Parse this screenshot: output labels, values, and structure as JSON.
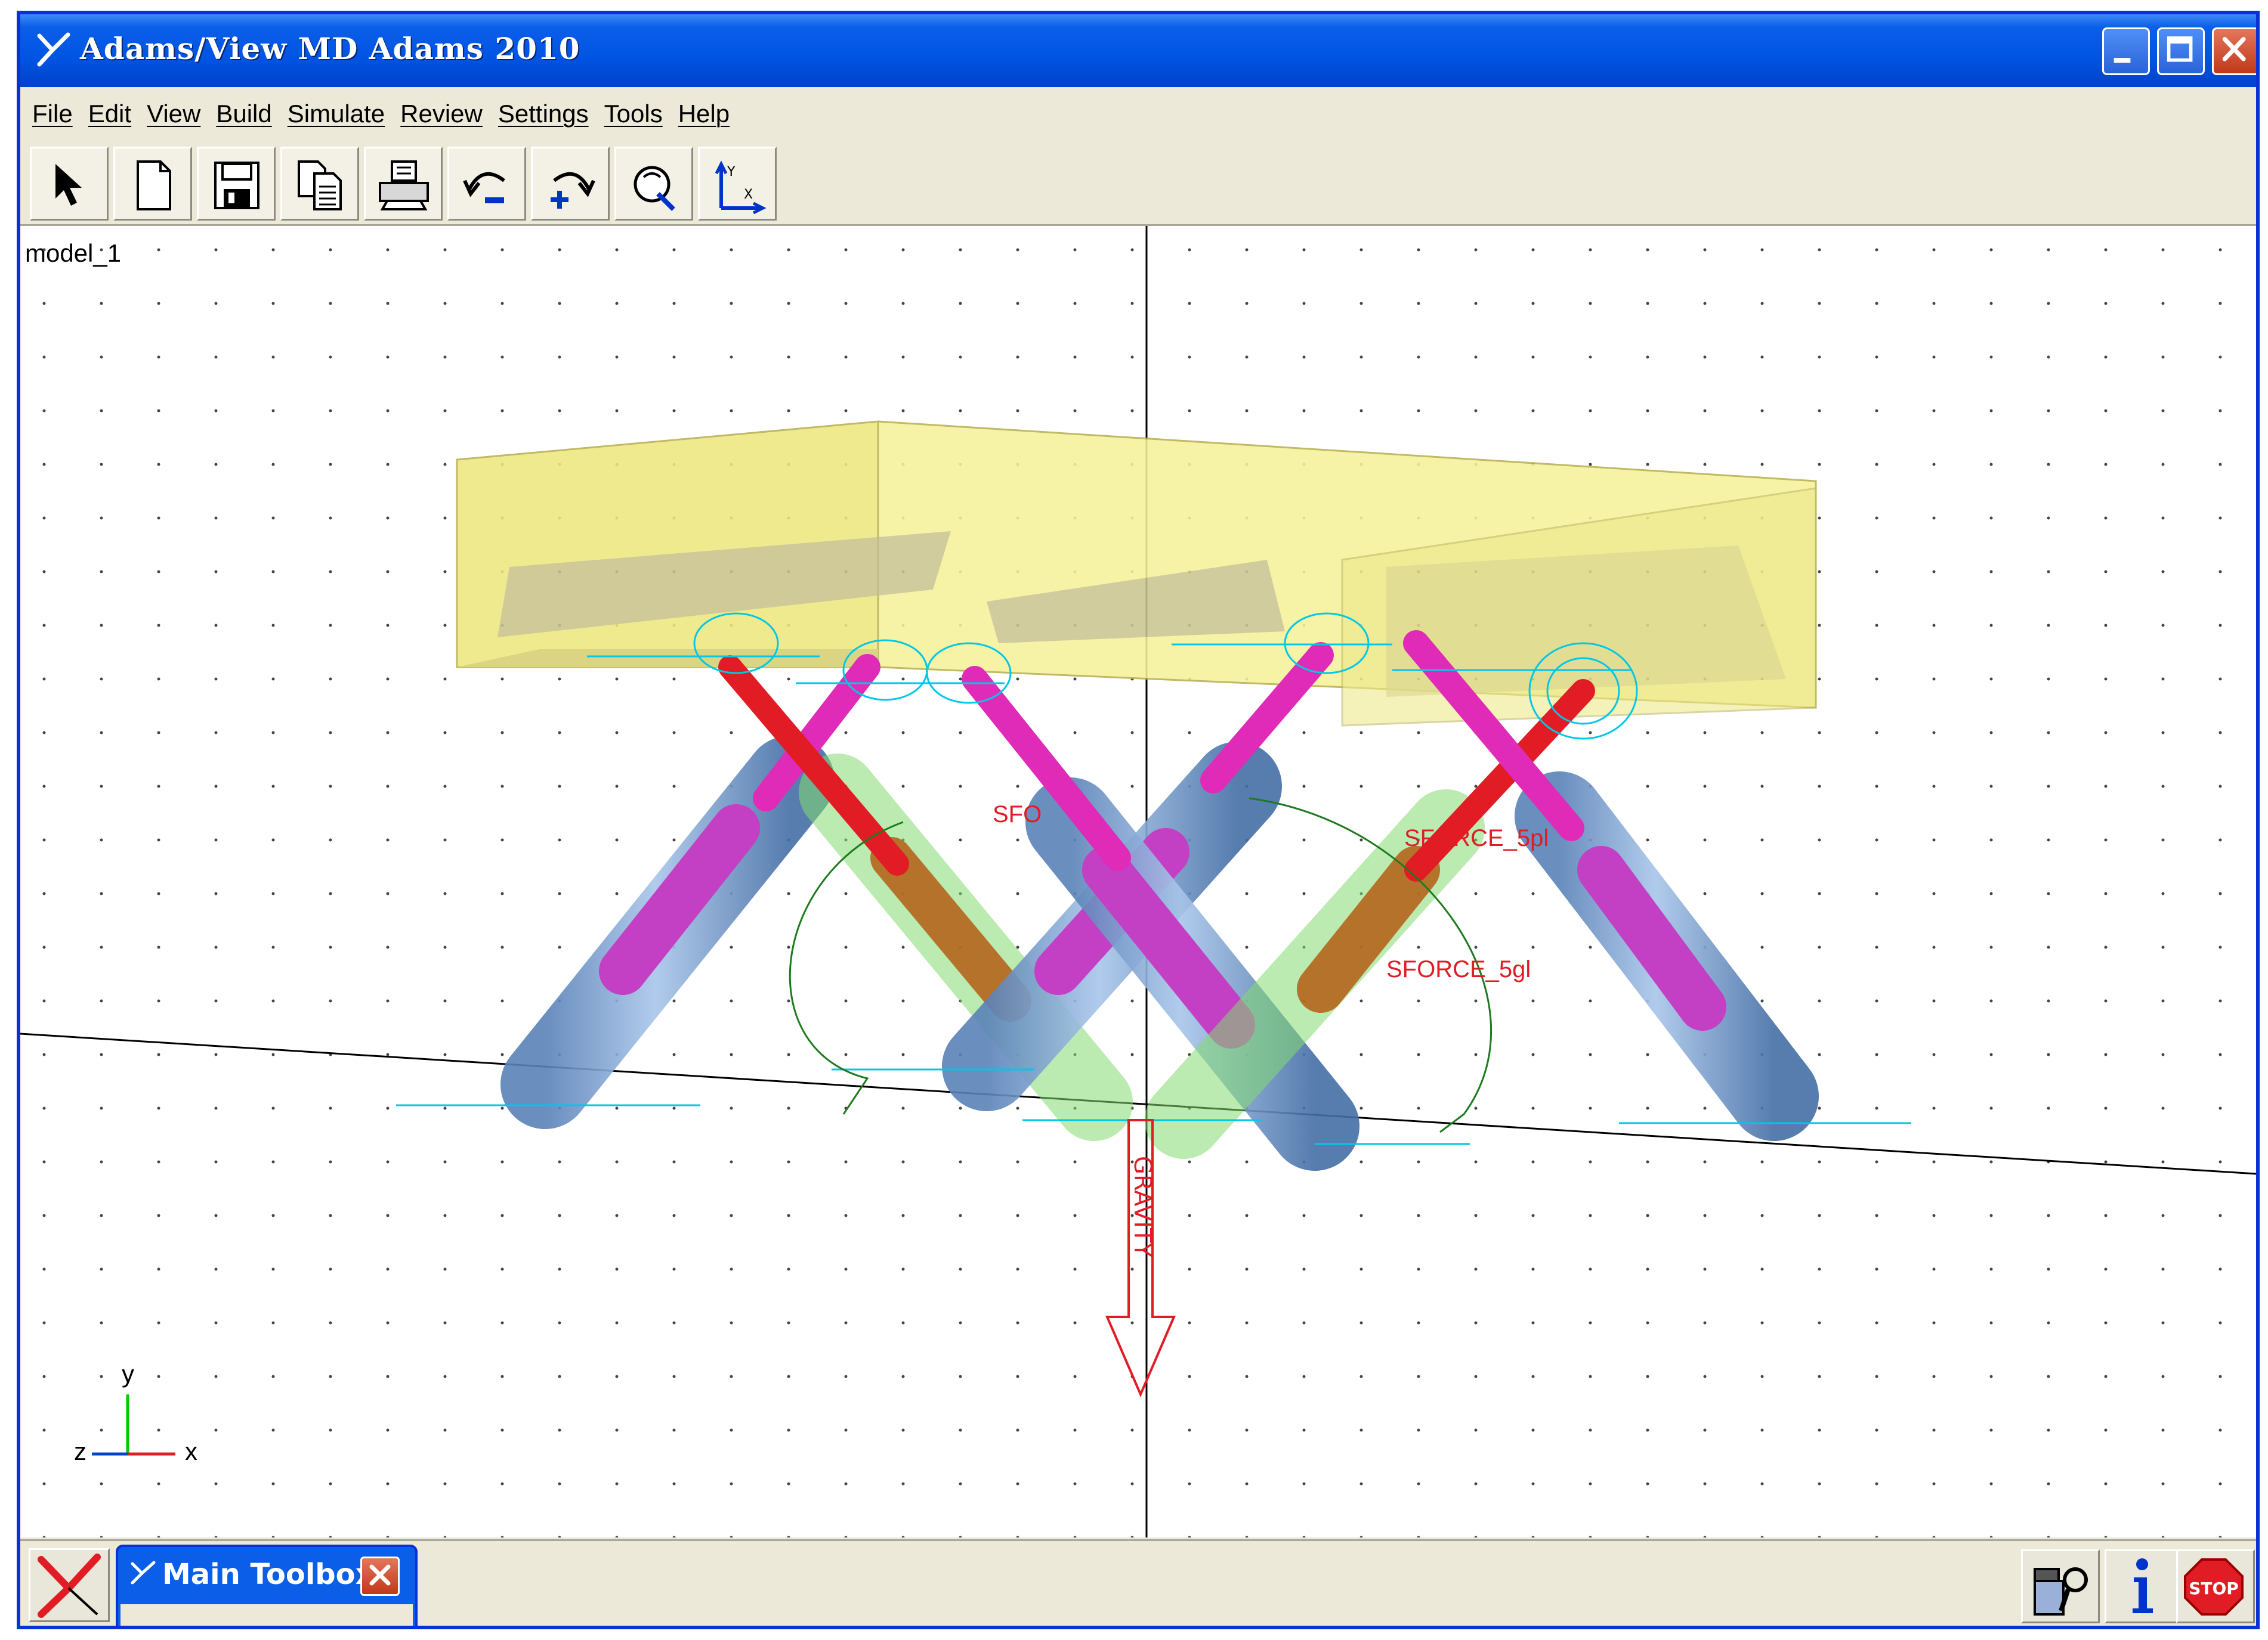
{
  "window": {
    "title": "Adams/View MD Adams 2010"
  },
  "menu": {
    "items": [
      "File",
      "Edit",
      "View",
      "Build",
      "Simulate",
      "Review",
      "Settings",
      "Tools",
      "Help"
    ]
  },
  "toolbar": {
    "buttons": [
      "select-icon",
      "new-model-icon",
      "save-icon",
      "copy-icon",
      "print-icon",
      "undo-icon",
      "redo-icon",
      "view-control-icon",
      "coordinate-system-icon"
    ]
  },
  "viewport": {
    "model_name": "model_1",
    "labels": {
      "sforce_a": "SFO",
      "sforce_b": "SFORCE_5pl",
      "sforce_c": "SFORCE_5gl",
      "gravity": "GRAVITY",
      "axis_x": "x",
      "axis_y": "y",
      "axis_z": "z"
    },
    "colors": {
      "platform": "#f5f08a",
      "cylinder": "#7aa6d6",
      "piston": "#c83cc8",
      "rod_red": "#e21c24",
      "rod_magenta": "#e02ab8",
      "green_cyl": "#8ee07a",
      "marker": "#00c8e6",
      "gravity": "#e21c24"
    }
  },
  "status": {
    "toolbox_title": "Main Toolbox"
  }
}
